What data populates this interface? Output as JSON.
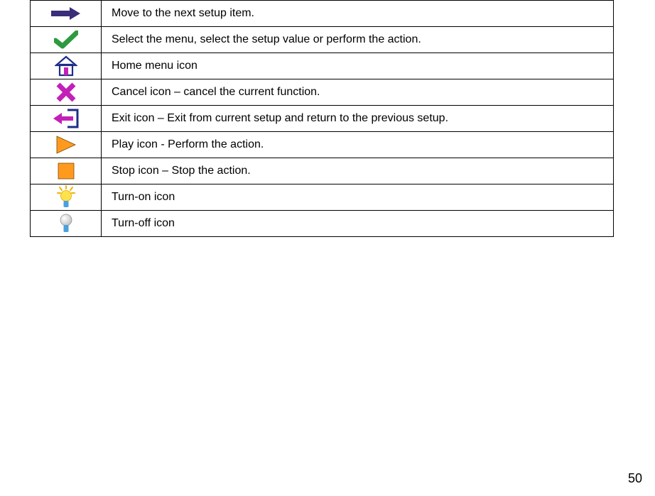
{
  "rows": [
    {
      "icon": "next-arrow-icon",
      "desc": "Move to the next setup item."
    },
    {
      "icon": "check-icon",
      "desc": "Select the menu, select the setup value or perform the action."
    },
    {
      "icon": "home-icon",
      "desc": "Home menu icon"
    },
    {
      "icon": "cancel-x-icon",
      "desc": "Cancel icon – cancel the current function."
    },
    {
      "icon": "exit-icon",
      "desc": "Exit icon – Exit from current setup and return to the previous setup."
    },
    {
      "icon": "play-icon",
      "desc": "Play icon - Perform the action."
    },
    {
      "icon": "stop-icon",
      "desc": "Stop icon – Stop the action."
    },
    {
      "icon": "turn-on-icon",
      "desc": "Turn-on icon"
    },
    {
      "icon": "turn-off-icon",
      "desc": "Turn-off icon"
    }
  ],
  "page_number": "50"
}
